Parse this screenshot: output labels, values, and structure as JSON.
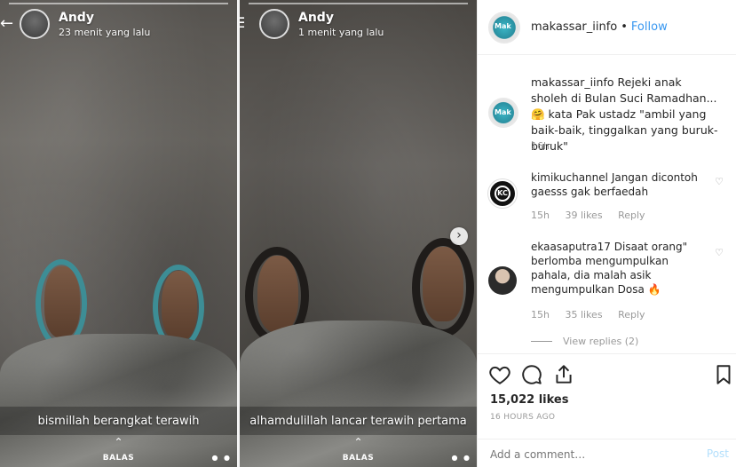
{
  "stories": [
    {
      "name": "Andy",
      "time": "23 menit yang lalu",
      "caption": "bismillah berangkat terawih",
      "reply": "BALAS"
    },
    {
      "name": "Andy",
      "time": "1 menit yang lalu",
      "caption": "alhamdulillah lancar terawih pertama",
      "reply": "BALAS"
    }
  ],
  "header": {
    "username": "makassar_iinfo",
    "separator": "•",
    "follow": "Follow",
    "avatar_text": "Mak"
  },
  "caption": {
    "username": "makassar_iinfo",
    "text": "Rejeki anak sholeh di Bulan Suci Ramadhan...🤗 kata Pak ustadz \"ambil yang baik-baik, tinggalkan yang buruk-buruk\"",
    "time": "16h"
  },
  "comments": [
    {
      "username": "kimikuchannel",
      "text": "Jangan dicontoh gaesss gak berfaedah",
      "time": "15h",
      "likes": "39 likes",
      "reply": "Reply"
    },
    {
      "username": "ekaasaputra17",
      "text": "Disaat orang\" berlomba mengumpulkan pahala, dia malah asik mengumpulkan Dosa 🔥",
      "time": "15h",
      "likes": "35 likes",
      "reply": "Reply"
    }
  ],
  "view_replies": "View replies (2)",
  "likes": "15,022 likes",
  "post_time": "16 HOURS AGO",
  "add_comment": {
    "placeholder": "Add a comment…",
    "post": "Post"
  },
  "icons": {
    "heart": "heart-icon",
    "comment": "comment-icon",
    "share": "share-icon",
    "save": "bookmark-icon"
  },
  "colors": {
    "link": "#3897f0",
    "muted": "#999999",
    "post_disabled": "#b2dffc"
  }
}
